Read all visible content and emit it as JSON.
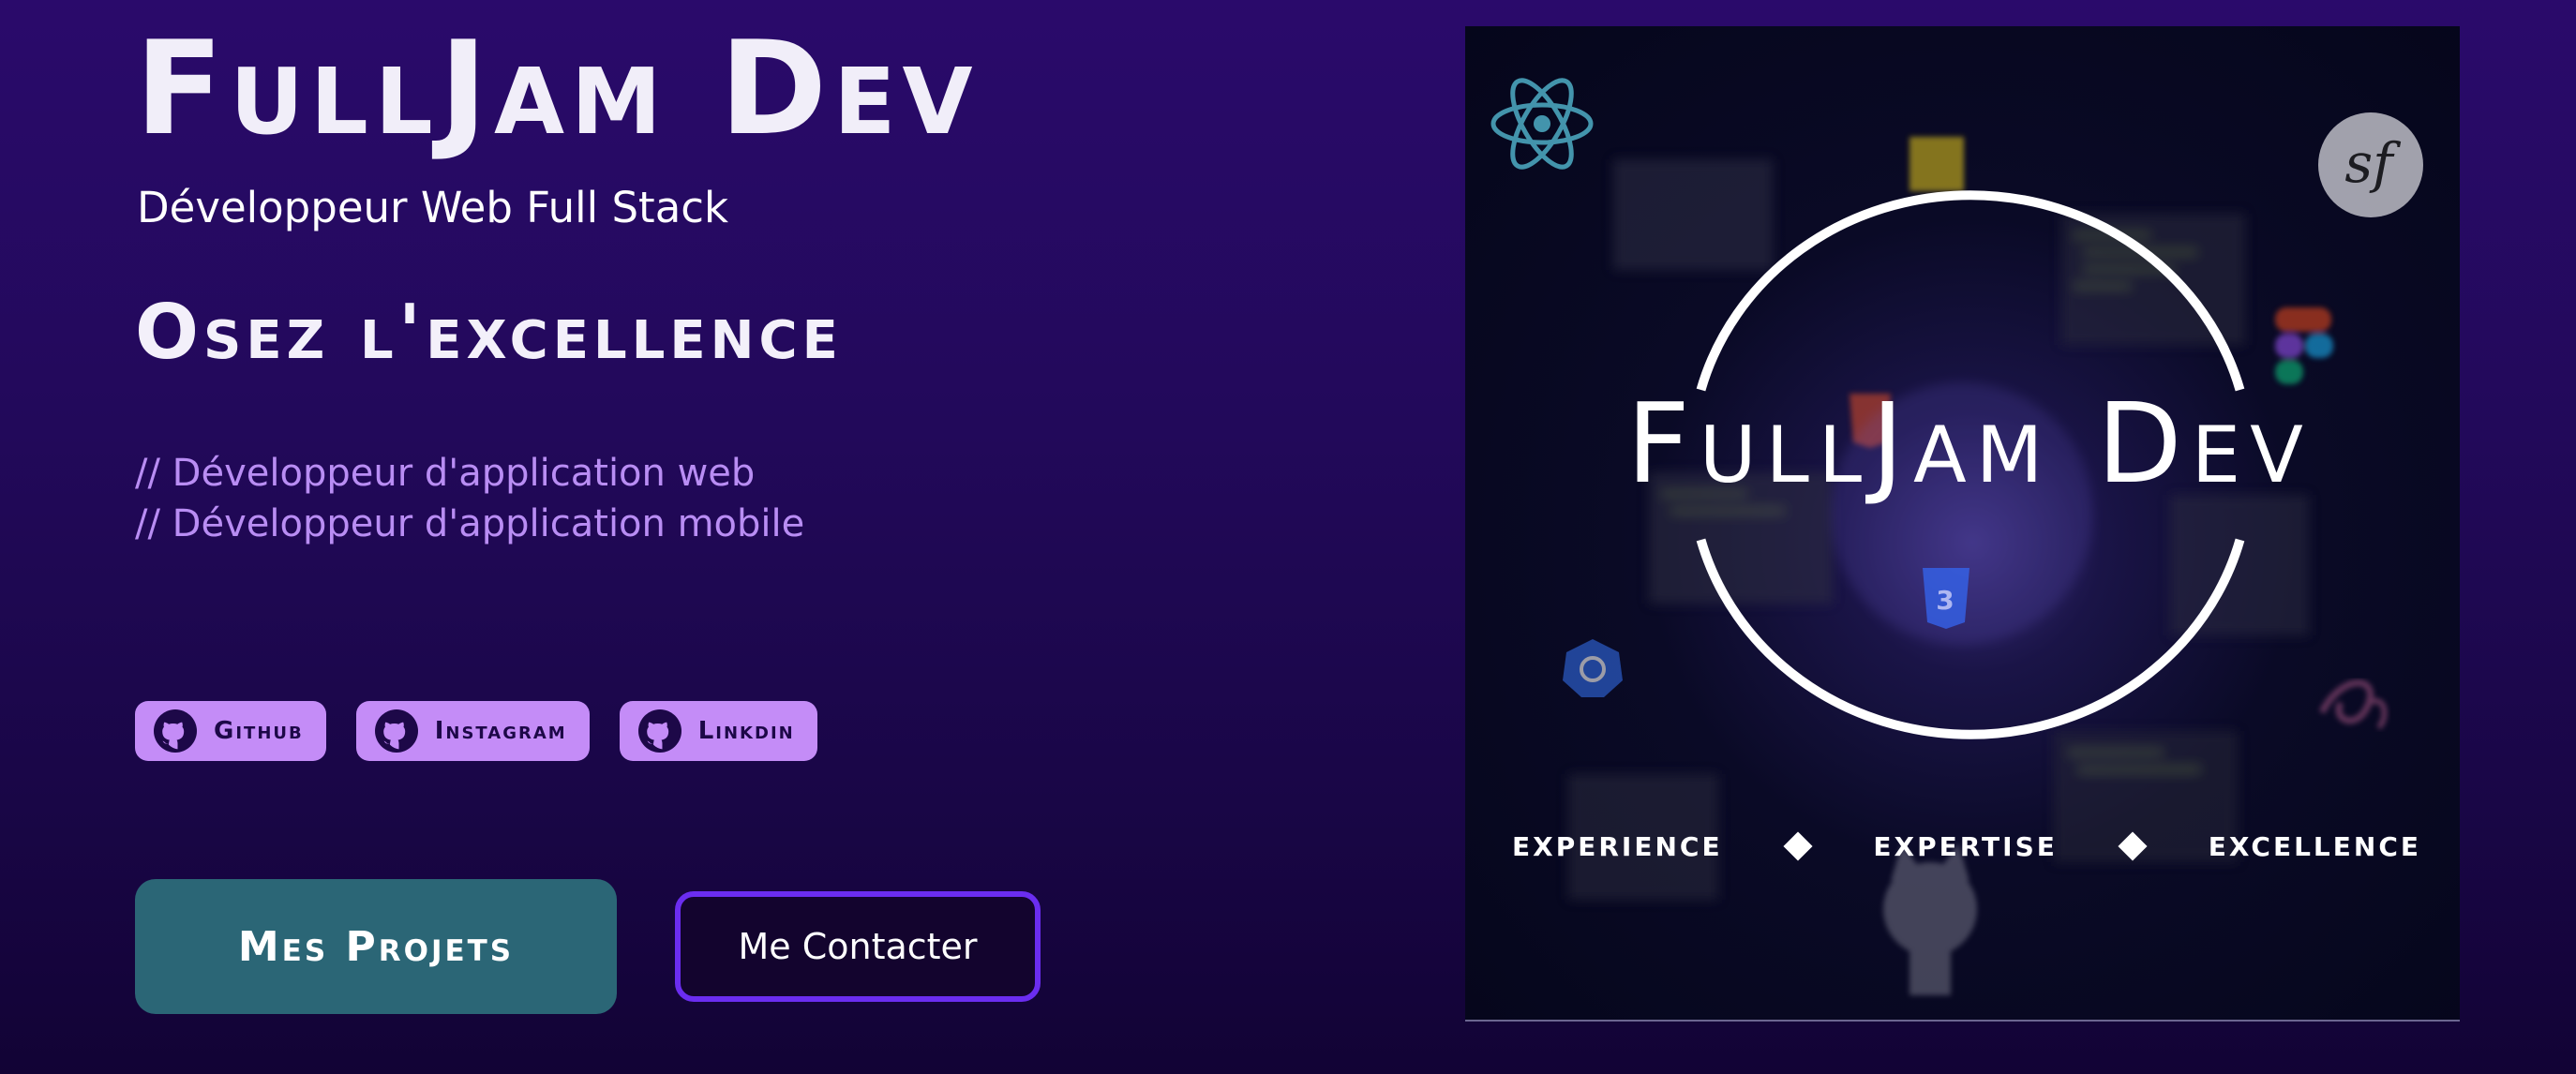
{
  "hero": {
    "title": "FullJam Dev",
    "subtitle": "Développeur Web Full Stack",
    "tagline": "Osez l'excellence",
    "roles": [
      "// Développeur d'application web",
      "// Développeur d'application mobile"
    ]
  },
  "social": [
    {
      "label": "Github",
      "icon": "github-icon"
    },
    {
      "label": "Instagram",
      "icon": "github-icon"
    },
    {
      "label": "Linkdin",
      "icon": "github-icon"
    }
  ],
  "cta": {
    "projects_label": "Mes Projets",
    "contact_label": "Me Contacter"
  },
  "image": {
    "logo_text": "FullJam Dev",
    "values": [
      "EXPERIENCE",
      "EXPERTISE",
      "EXCELLENCE"
    ],
    "tech_icons": [
      "react-icon",
      "symfony-icon",
      "javascript-icon",
      "figma-icon",
      "html5-icon",
      "css3-icon",
      "kubernetes-icon",
      "sass-icon",
      "github-icon"
    ]
  },
  "colors": {
    "background_top": "#2a0a6b",
    "background_bottom": "#120335",
    "accent_purple": "#b98df4",
    "social_button_bg": "#c48cf7",
    "projects_button_bg": "#2b6676",
    "contact_button_border": "#6b2df0"
  }
}
